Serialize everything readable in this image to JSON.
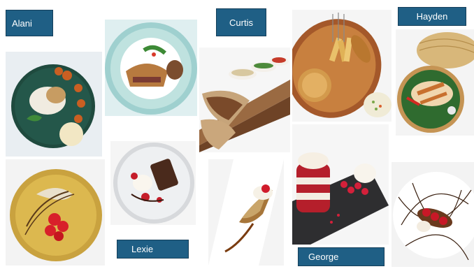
{
  "labels": {
    "alani": "Alani",
    "curtis": "Curtis",
    "hayden": "Hayden",
    "lexie": "Lexie",
    "george": "George"
  },
  "colors": {
    "label_background": "#1f5f85",
    "label_text": "#ffffff"
  }
}
